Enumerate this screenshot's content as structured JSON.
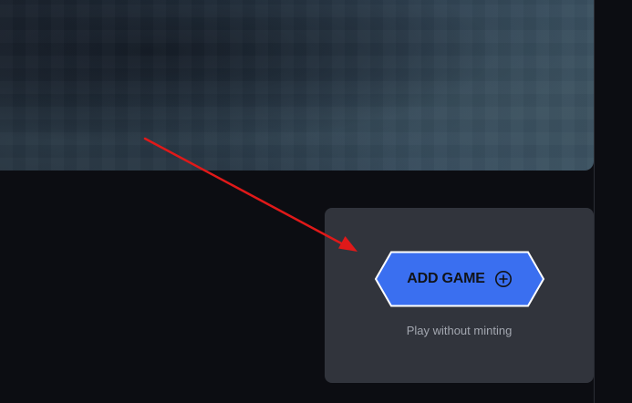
{
  "card": {
    "button_label": "ADD GAME",
    "subtext": "Play without minting",
    "button_icon": "plus-circle-icon"
  },
  "annotation": {
    "arrow_icon": "red-arrow-icon"
  },
  "colors": {
    "page_background": "#0c0d12",
    "card_background": "#31343c",
    "button_fill": "#3a6ff0",
    "button_border": "#ffffff",
    "arrow": "#e01919",
    "subtext": "#a3a7b0"
  }
}
